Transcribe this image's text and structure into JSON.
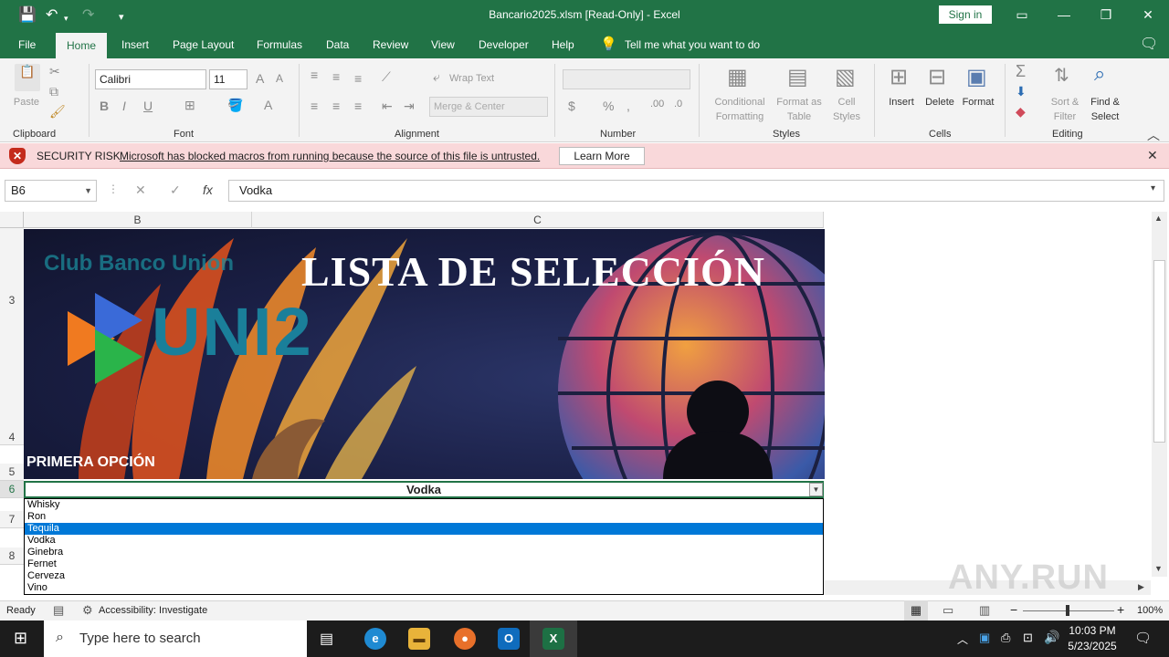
{
  "titlebar": {
    "title": "Bancario2025.xlsm  [Read-Only]  -  Excel",
    "sign_in": "Sign in"
  },
  "menu": {
    "tabs": [
      "File",
      "Home",
      "Insert",
      "Page Layout",
      "Formulas",
      "Data",
      "Review",
      "View",
      "Developer",
      "Help"
    ],
    "tell_me": "Tell me what you want to do"
  },
  "ribbon": {
    "clipboard": {
      "paste": "Paste",
      "label": "Clipboard"
    },
    "font": {
      "name": "Calibri",
      "size": "11",
      "label": "Font"
    },
    "alignment": {
      "wrap_text": "Wrap Text",
      "merge_center": "Merge & Center",
      "label": "Alignment"
    },
    "number": {
      "label": "Number"
    },
    "styles": {
      "conditional": "Conditional",
      "formatting": "Formatting",
      "format_as": "Format as",
      "table": "Table",
      "cell": "Cell",
      "styles": "Styles",
      "label": "Styles"
    },
    "cells": {
      "insert": "Insert",
      "delete": "Delete",
      "format": "Format",
      "label": "Cells"
    },
    "editing": {
      "sort": "Sort &",
      "filter": "Filter",
      "find": "Find &",
      "select": "Select",
      "label": "Editing"
    }
  },
  "security": {
    "label": "SECURITY RISK",
    "message": "Microsoft has blocked macros from running because the source of this file is untrusted.",
    "learn_more": "Learn More"
  },
  "formula_bar": {
    "name_box": "B6",
    "value": "Vodka"
  },
  "grid": {
    "columns": [
      "B",
      "C"
    ],
    "rows": [
      "3",
      "4",
      "5",
      "6",
      "7",
      "8"
    ]
  },
  "banner": {
    "club": "Club Banco Union",
    "logo_text": "UNI2",
    "title": "LISTA DE SELECCIÓN",
    "primera": "PRIMERA OPCIÓN"
  },
  "cell_b6": "Vodka",
  "dropdown": {
    "options": [
      "Whisky",
      "Ron",
      "Tequila",
      "Vodka",
      "Ginebra",
      "Fernet",
      "Cerveza",
      "Vino"
    ],
    "highlighted": "Tequila"
  },
  "status": {
    "ready": "Ready",
    "accessibility": "Accessibility: Investigate",
    "zoom": "100%"
  },
  "taskbar": {
    "search_placeholder": "Type here to search",
    "time": "10:03 PM",
    "date": "5/23/2025"
  },
  "watermark": "ANY.RUN",
  "colors": {
    "excel_green": "#217346",
    "security_bg": "#f9d8da",
    "selection_blue": "#0078d7"
  }
}
